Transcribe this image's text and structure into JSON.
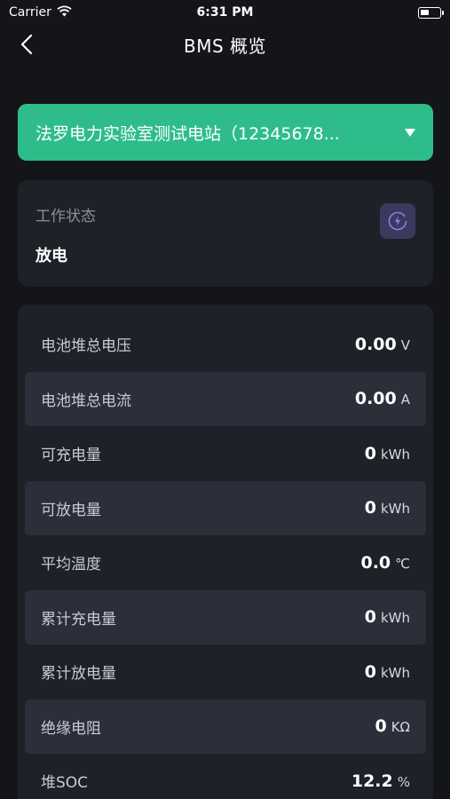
{
  "status_bar": {
    "carrier": "Carrier",
    "time": "6:31 PM"
  },
  "nav": {
    "title": "BMS 概览"
  },
  "station": {
    "selected": "法罗电力实验室测试电站（12345678..."
  },
  "work_status": {
    "label": "工作状态",
    "value": "放电"
  },
  "metrics": [
    {
      "label": "电池堆总电压",
      "value": "0.00",
      "unit": "V"
    },
    {
      "label": "电池堆总电流",
      "value": "0.00",
      "unit": "A"
    },
    {
      "label": "可充电量",
      "value": "0",
      "unit": "kWh"
    },
    {
      "label": "可放电量",
      "value": "0",
      "unit": "kWh"
    },
    {
      "label": "平均温度",
      "value": "0.0",
      "unit": "℃"
    },
    {
      "label": "累计充电量",
      "value": "0",
      "unit": "kWh"
    },
    {
      "label": "累计放电量",
      "value": "0",
      "unit": "kWh"
    },
    {
      "label": "绝缘电阻",
      "value": "0",
      "unit": "KΩ"
    },
    {
      "label": "堆SOC",
      "value": "12.2",
      "unit": "%"
    }
  ],
  "colors": {
    "accent": "#2ebd8a",
    "background": "#141519",
    "card": "#1f2128",
    "row_alt": "#2c2f3a",
    "status_icon_bg": "#3a3a5e",
    "status_icon": "#8a7fe0"
  },
  "icons": {
    "back": "chevron-left-icon",
    "wifi": "wifi-icon",
    "battery": "battery-icon",
    "dropdown": "caret-down-icon",
    "status": "lightning-bolt-icon"
  }
}
